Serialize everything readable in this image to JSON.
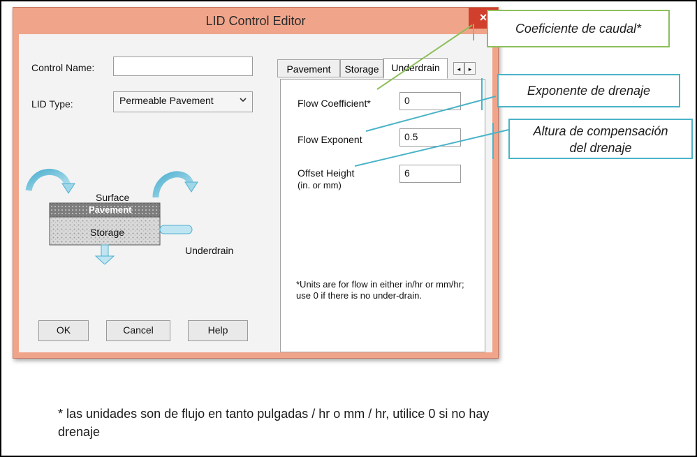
{
  "dialog": {
    "title": "LID Control Editor",
    "close_glyph": "×"
  },
  "form": {
    "control_name_label": "Control Name:",
    "control_name_value": "",
    "lid_type_label": "LID Type:",
    "lid_type_value": "Permeable Pavement"
  },
  "diagram": {
    "surface_label": "Surface",
    "pavement_label": "Pavement",
    "storage_label": "Storage",
    "underdrain_label": "Underdrain"
  },
  "buttons": {
    "ok": "OK",
    "cancel": "Cancel",
    "help": "Help"
  },
  "tabs": [
    "Pavement",
    "Storage",
    "Underdrain"
  ],
  "underdrain": {
    "flow_coefficient_label": "Flow Coefficient*",
    "flow_coefficient_value": "0",
    "flow_exponent_label": "Flow Exponent",
    "flow_exponent_value": "0.5",
    "offset_height_label_1": "Offset Height",
    "offset_height_label_2": "(in. or mm)",
    "offset_height_value": "6",
    "note": "*Units are for flow in either in/hr or mm/hr; use 0 if there is no under-drain."
  },
  "callouts": {
    "coeficiente": "Coeficiente de caudal*",
    "exponente": "Exponente de drenaje",
    "altura_1": "Altura de compensación",
    "altura_2": "del drenaje"
  },
  "footnote": "* las unidades son de flujo en tanto pulgadas / hr o mm / hr, utilice 0 si no hay drenaje",
  "colors": {
    "dialog_frame": "#f0a58b",
    "close_button": "#d13f2d",
    "callout_green": "#8dbf5a",
    "callout_blue": "#4ab3c8"
  },
  "icons": {
    "close": "close-icon",
    "scroll_left": "chevron-left-icon",
    "scroll_right": "chevron-right-icon",
    "dropdown": "chevron-down-icon"
  }
}
